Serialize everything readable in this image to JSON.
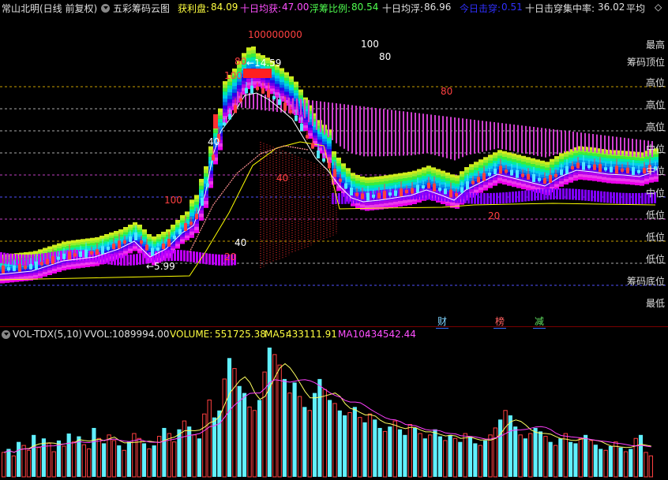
{
  "header": {
    "stock_title": "常山北明(日线 前复权)",
    "indicator_name": "五彩筹码云图",
    "profit_label": "获利盘:",
    "profit_value": "84.09",
    "ten_day_profit_label": "十日均获:",
    "ten_day_profit_value": "47.00",
    "float_ratio_label": "浮筹比例:",
    "float_ratio_value": "80.54",
    "ten_day_float_label": "十日均浮:",
    "ten_day_float_value": "86.96",
    "today_break_label": "今日击穿:",
    "today_break_value": "0.51",
    "ten_day_break_label": "十日击穿集中率:",
    "ten_day_break_value": "36.02",
    "tail_text": "平均",
    "diamond_icon": "diamond-icon"
  },
  "right_labels": [
    "最高",
    "筹码顶位",
    "高位",
    "高位",
    "高位",
    "中位",
    "中位",
    "中位",
    "低位",
    "低位",
    "低位",
    "筹码底位",
    "最低"
  ],
  "event_tags": [
    {
      "text": "财",
      "color": "#7fd4ff"
    },
    {
      "text": "榜",
      "color": "#ff6060"
    },
    {
      "text": "减",
      "color": "#60e060"
    }
  ],
  "indicator": {
    "name": "VOL-TDX(5,10)",
    "vvol_label": "VVOL:",
    "vvol_value": "1089994.00",
    "volume_label": "VOLUME:",
    "volume_value": "551725.38",
    "ma5_label": "MA5:",
    "ma5_value": "433111.91",
    "ma10_label": "MA10:",
    "ma10_value": "434542.44"
  },
  "colors": {
    "up_candle": "#ff4040",
    "down_candle": "#50e8ff",
    "ma5": "#ffffff",
    "ma10": "#ffff00",
    "grid_yellow": "#c8a000",
    "grid_white": "#aaaaaa",
    "grid_magenta": "#c040c0",
    "grid_blue": "#5050ff",
    "vol_ma5": "#ffff60",
    "vol_ma10": "#ff40ff"
  },
  "chart_data": {
    "type": "candlestick_with_volume",
    "annotations": [
      {
        "text": "100000000"
      },
      {
        "text": "←14.59"
      },
      {
        "text": "←5.99"
      },
      {
        "text": "100"
      },
      {
        "text": "80"
      },
      {
        "text": "80"
      },
      {
        "text": "100"
      },
      {
        "text": "80"
      },
      {
        "text": "100"
      },
      {
        "text": "40"
      },
      {
        "text": "40"
      },
      {
        "text": "20"
      },
      {
        "text": "40"
      },
      {
        "text": "20"
      }
    ],
    "price_high": 14.59,
    "price_low": 5.99,
    "volume_series": [
      35,
      40,
      30,
      50,
      45,
      38,
      60,
      42,
      55,
      48,
      36,
      52,
      44,
      62,
      50,
      58,
      46,
      40,
      70,
      55,
      48,
      60,
      52,
      45,
      38,
      50,
      62,
      55,
      48,
      40,
      45,
      58,
      70,
      62,
      50,
      68,
      80,
      72,
      60,
      55,
      90,
      110,
      85,
      95,
      140,
      170,
      155,
      130,
      120,
      100,
      95,
      110,
      150,
      185,
      175,
      160,
      140,
      120,
      135,
      115,
      100,
      95,
      120,
      140,
      125,
      110,
      105,
      95,
      88,
      92,
      100,
      85,
      78,
      90,
      82,
      70,
      65,
      72,
      80,
      68,
      60,
      75,
      70,
      62,
      55,
      60,
      68,
      58,
      52,
      60,
      55,
      50,
      62,
      58,
      48,
      45,
      52,
      60,
      70,
      82,
      95,
      88,
      72,
      60,
      55,
      62,
      70,
      65,
      58,
      50,
      45,
      55,
      62,
      50,
      48,
      55,
      60,
      52,
      46,
      40,
      38,
      44,
      50,
      42,
      36,
      40,
      55,
      60,
      35,
      30
    ],
    "volume_colors": [
      0,
      1,
      0,
      1,
      0,
      0,
      1,
      0,
      1,
      0,
      0,
      1,
      0,
      1,
      0,
      1,
      0,
      0,
      1,
      0,
      1,
      0,
      0,
      1,
      0,
      1,
      0,
      0,
      1,
      0,
      1,
      0,
      1,
      0,
      0,
      1,
      0,
      1,
      0,
      1,
      0,
      0,
      1,
      1,
      0,
      1,
      0,
      1,
      1,
      0,
      0,
      1,
      0,
      1,
      0,
      0,
      1,
      0,
      1,
      0,
      1,
      0,
      1,
      1,
      0,
      1,
      0,
      1,
      1,
      0,
      1,
      0,
      1,
      0,
      1,
      1,
      0,
      1,
      0,
      1,
      1,
      0,
      1,
      0,
      1,
      0,
      1,
      1,
      0,
      1,
      0,
      1,
      0,
      1,
      1,
      0,
      1,
      0,
      0,
      1,
      0,
      1,
      1,
      0,
      1,
      0,
      1,
      1,
      0,
      1,
      0,
      1,
      0,
      1,
      1,
      0,
      1,
      0,
      1,
      1,
      0,
      1,
      0,
      1,
      0,
      1,
      0,
      1,
      0,
      0
    ]
  }
}
